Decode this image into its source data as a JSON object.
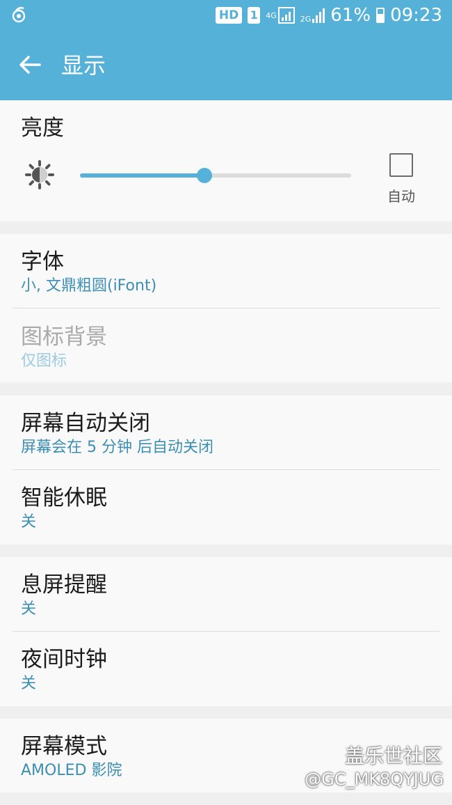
{
  "status_bar": {
    "hd_badge": "HD",
    "sim_badge": "1",
    "net_4g": "4G",
    "net_2g": "2G",
    "battery": "61%",
    "time": "09:23"
  },
  "app_bar": {
    "title": "显示"
  },
  "brightness": {
    "title": "亮度",
    "level": 0.46,
    "auto_label": "自动",
    "auto_checked": false
  },
  "sections": [
    {
      "rows": [
        {
          "title": "字体",
          "subtitle": "小, 文鼎粗圆(iFont)",
          "enabled": true
        },
        {
          "title": "图标背景",
          "subtitle": "仅图标",
          "enabled": false
        }
      ]
    },
    {
      "rows": [
        {
          "title": "屏幕自动关闭",
          "subtitle": "屏幕会在 5 分钟 后自动关闭",
          "enabled": true
        },
        {
          "title": "智能休眠",
          "subtitle": "关",
          "enabled": true
        }
      ]
    },
    {
      "rows": [
        {
          "title": "息屏提醒",
          "subtitle": "关",
          "enabled": true
        },
        {
          "title": "夜间时钟",
          "subtitle": "关",
          "enabled": true
        }
      ]
    },
    {
      "rows": [
        {
          "title": "屏幕模式",
          "subtitle": "AMOLED 影院",
          "enabled": true
        }
      ]
    }
  ],
  "watermark": {
    "line1": "盖乐世社区",
    "line2": "@GC_MK8QYJUG"
  },
  "colors": {
    "accent": "#55b1d8",
    "subtitle": "#3b8fb4"
  }
}
